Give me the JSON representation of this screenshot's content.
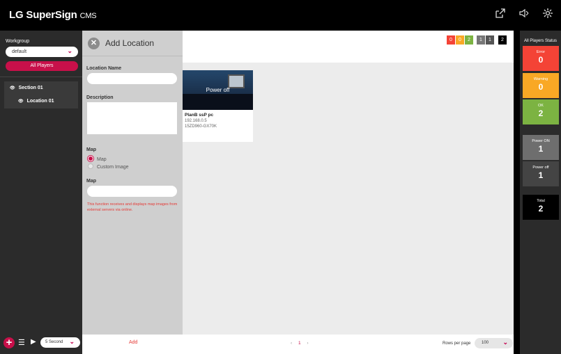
{
  "app": {
    "title_main": "LG SuperSign",
    "title_suffix": "CMS"
  },
  "topbar": {
    "icons": [
      "export-icon",
      "volume-icon",
      "settings-icon"
    ]
  },
  "sidebar": {
    "workgroup_label": "Workgroup",
    "workgroup_value": "default",
    "all_players_label": "All Players",
    "tree": [
      {
        "label": "Section 01"
      },
      {
        "label": "Location 01"
      }
    ],
    "interval_value": "5 Second"
  },
  "panel": {
    "title": "Add Location",
    "location_name_label": "Location Name",
    "description_label": "Description",
    "map_label": "Map",
    "radio_map": "Map",
    "radio_custom": "Custom Image",
    "map_field_label": "Map",
    "note": "This function receives and displays map images from external servers via online.",
    "add_label": "Add"
  },
  "main": {
    "counts": {
      "error": "0",
      "warning": "0",
      "ok": "2",
      "power_on": "1",
      "power_off": "1",
      "total": "2"
    },
    "card": {
      "overlay": "Power off",
      "name": "PlanB ssP pc",
      "ip": "192.168.0.5",
      "serial": "15ZD960-GX70K"
    },
    "pager": {
      "prev": "‹",
      "current": "1",
      "next": "›"
    },
    "rows_label": "Rows per page",
    "rows_value": "100"
  },
  "status": {
    "title": "All Players Status",
    "error_label": "Error",
    "error_value": "0",
    "warning_label": "Warning",
    "warning_value": "0",
    "ok_label": "OK",
    "ok_value": "2",
    "power_on_label": "Power ON",
    "power_on_value": "1",
    "power_off_label": "Power off",
    "power_off_value": "1",
    "total_label": "Total",
    "total_value": "2"
  },
  "colors": {
    "accent": "#c8104a",
    "error": "#f44336",
    "warning": "#f9a825",
    "ok": "#7cb342"
  }
}
